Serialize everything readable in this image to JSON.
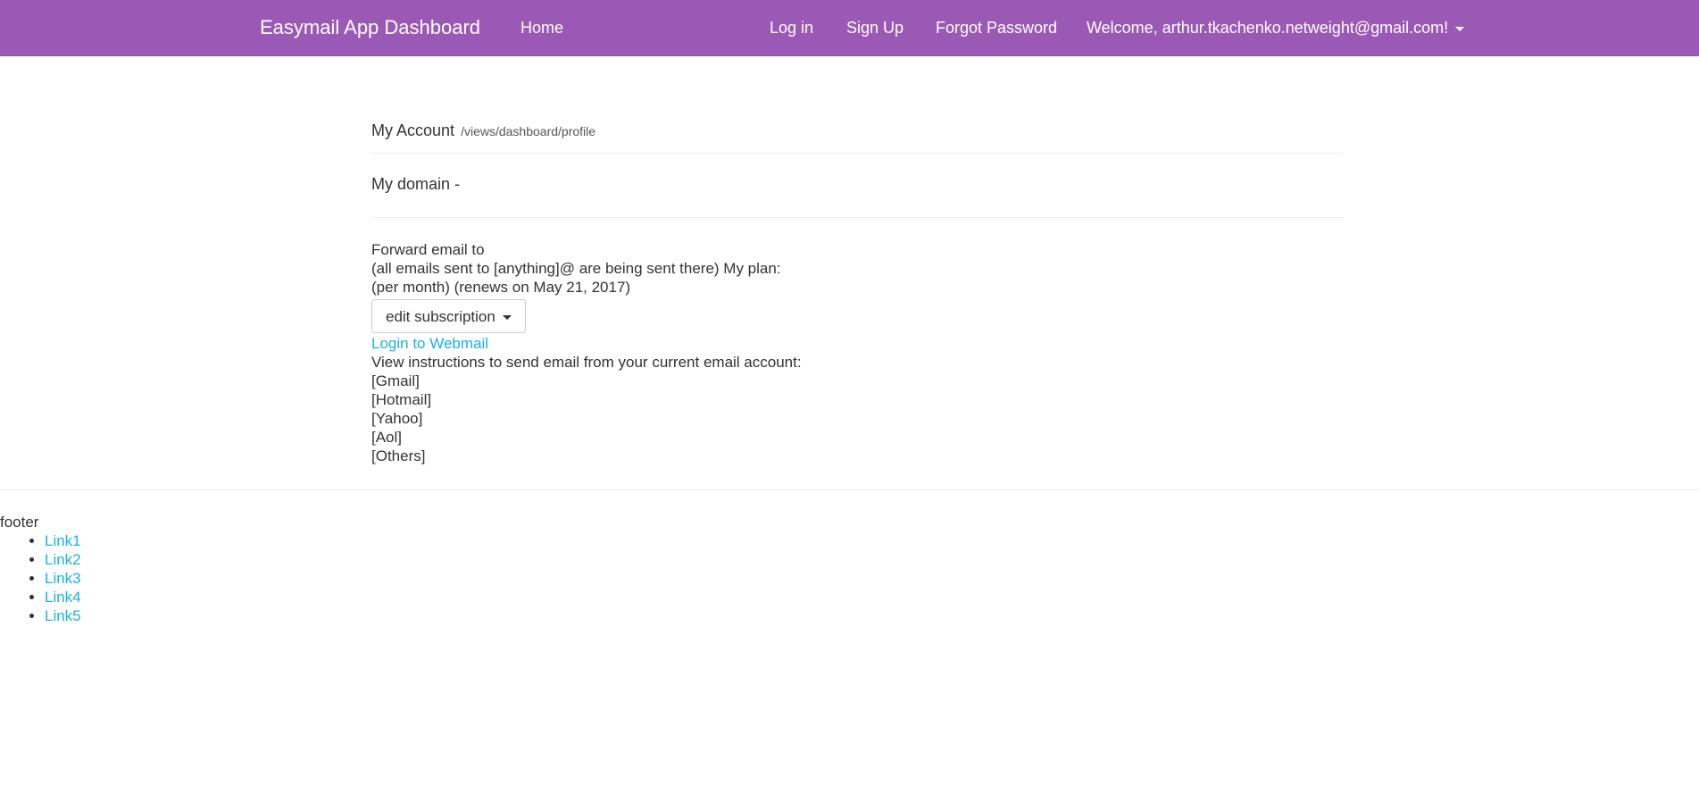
{
  "navbar": {
    "brand": "Easymail App Dashboard",
    "home": "Home",
    "login": "Log in",
    "signup": "Sign Up",
    "forgot": "Forgot Password",
    "welcome": "Welcome, arthur.tkachenko.netweight@gmail.com!",
    "background": "#9b59b6"
  },
  "header": {
    "title": "My Account",
    "path": "/views/dashboard/profile"
  },
  "domain": {
    "label": "My domain -"
  },
  "info": {
    "forward_line": "Forward email to",
    "sent_line": "(all emails sent to [anything]@ are being sent there) My plan:",
    "renew_line": "(per month) (renews on May 21, 2017)",
    "edit_button": "edit subscription",
    "webmail_link": "Login to Webmail",
    "instructions": "View instructions to send email from your current email account:",
    "providers": [
      "[Gmail]",
      "[Hotmail]",
      "[Yahoo]",
      "[Aol]",
      "[Others]"
    ]
  },
  "footer": {
    "label": "footer",
    "links": [
      "Link1",
      "Link2",
      "Link3",
      "Link4",
      "Link5"
    ]
  },
  "colors": {
    "link": "#1ab2e8",
    "text": "#333333"
  }
}
